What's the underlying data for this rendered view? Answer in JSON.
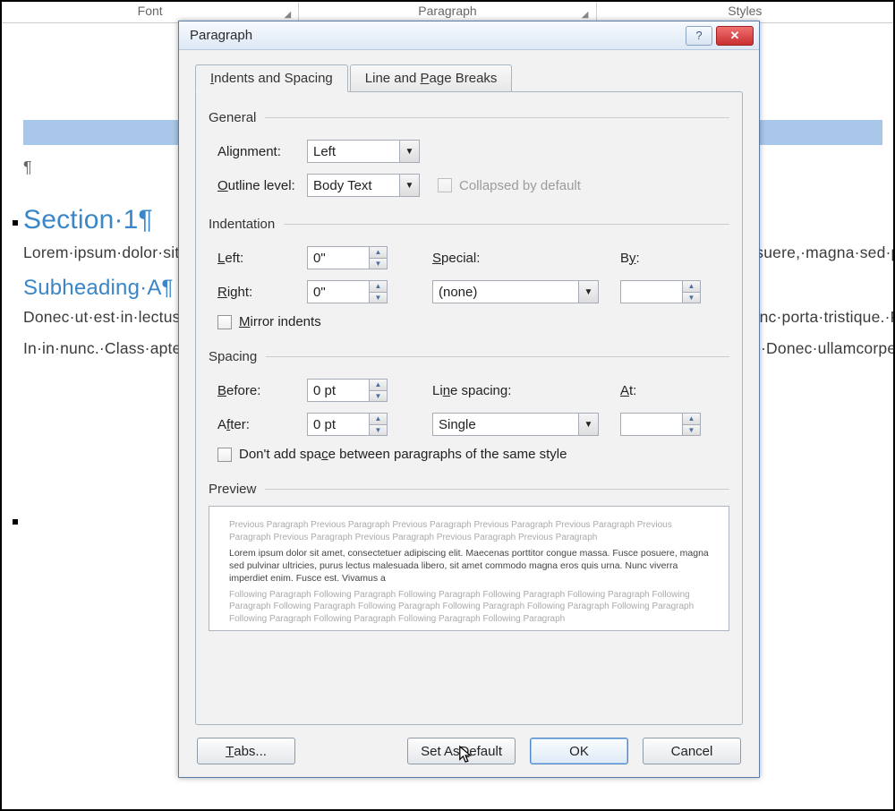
{
  "ribbon": {
    "font": "Font",
    "paragraph": "Paragraph",
    "styles": "Styles"
  },
  "doc": {
    "pilcrow": "¶",
    "h1": "Section·1¶",
    "p1": "Lorem·ipsum·dolor·sit·amet,·consectetuer·adipiscing·elit.·Maecenas·porttitor·congue·massa.·Fusce·posuere,·magna·sed·pulvinar·ultricies,·purus·lectus·malesuada·libero,·sit·amet·commodo·magna·eros·quis·urna.·Nunc·viverra·imperdiet·enim.·Fusce·est.·Vivamus·a·tellus.·Pellentesque·habitant·morbi·tristique·senectus·et·netus·et·malesuada·fames·ac·turpis·egestas.·Proin·pharetra·nonummy·pede.·Mauris·et·orci.·Aenean·nec·lorem.·In·porttitor.·Donec·laoreet·nonummy·augue.·Suspendisse·dui·purus,·scelerisque·at,·vulputate·vitae,·pretium·mattis,·nunc.·Mauris·eget·neque·at·sem·venenatis·eleifend.·Ut·nonummy.·Fusce·aliquet·pede·non·pede.·Suspendisse·dapibus·lorem·pellentesque·magna.·Integer·nulla.·Donec·blandit·feugiat·ligula.·Donec·hendrerit,·felis·et·imperdiet·euismod,·purus·ipsum·pretium·metus,·in·lacinia·nulla·nisl·eget·sapien.¶",
    "h2": "Subheading·A¶",
    "p2": "Donec·ut·est·in·lectus·consequat·consequat.·Etiam·eget·dui.·Aliquam·erat·volutpat.·Sed·at·lorem·in·nunc·porta·tristique.·Proin·nec·augue.·Quisque·aliquam·tempor·magna.·Pellentesque·habitant·morbi·tristique·senectus·et·netus·et·malesuada·fames·ac·turpis·egestas.·Nunc·ac·magna.·Maecenas·odio·dolor,·vulputate·vel,·auctor·ac,·accumsan·id,·felis.·Pellentesque·cursus·sagittis·felis.·Pellentesque·porttitor,·velit·lacinia·egestas·auctor,·diam·eros·tempus·arcu,·nec·vulputate·augue·magna·vel·risus.·Cras·non·magna·vel·ante·adipiscing·rhoncus.·Vivamus·a·mi.·Morbi·neque.·Aliquam·erat·volutpat.·Integer·ultrices·lobortis·eros.·Pellentesque·habitant·morbi·tristique·senectus·et·netus·et·malesuada·fames·ac·turpis·egestas.·Proin·semper,·ante·vitae·sollicitudin·posuere,·metus·quam·iaculis·nibh,·vitae·scelerisque·nunc·massa·eget·pede.·Sed·velit·urna,·interdum·vel,·ultricies·vel,·faucibus·at,·quam.·Donec·elit·est,·consectetuer·eget,·consequat·quis,·tempus·quis,·wisi.¶",
    "p3": "In·in·nunc.·Class·aptent·taciti·sociosqu·ad·litora·torquent·per·conubia·nostra,·per·inceptos·hymenaeos.·Donec·ullamcorper·fringilla·eros.·Fusce·in·sapien·eu·purus·dapibus·commodo.·Cum·sociis·natoque·"
  },
  "dialog": {
    "title": "Paragraph",
    "tabs": {
      "indents": "Indents and Spacing",
      "breaks": "Line and Page Breaks"
    },
    "general": {
      "label": "General",
      "alignment_lbl": "Alignment:",
      "alignment_val": "Left",
      "outline_lbl": "Outline level:",
      "outline_val": "Body Text",
      "collapsed": "Collapsed by default"
    },
    "indent": {
      "label": "Indentation",
      "left_lbl": "Left:",
      "left_val": "0\"",
      "right_lbl": "Right:",
      "right_val": "0\"",
      "special_lbl": "Special:",
      "special_val": "(none)",
      "by_lbl": "By:",
      "by_val": "",
      "mirror": "Mirror indents"
    },
    "spacing": {
      "label": "Spacing",
      "before_lbl": "Before:",
      "before_val": "0 pt",
      "after_lbl": "After:",
      "after_val": "0 pt",
      "line_lbl": "Line spacing:",
      "line_val": "Single",
      "at_lbl": "At:",
      "at_val": "",
      "same": "Don't add space between paragraphs of the same style"
    },
    "preview": {
      "label": "Preview",
      "prev": "Previous Paragraph Previous Paragraph Previous Paragraph Previous Paragraph Previous Paragraph Previous Paragraph Previous Paragraph Previous Paragraph Previous Paragraph Previous Paragraph",
      "sample": "Lorem ipsum dolor sit amet, consectetuer adipiscing elit. Maecenas porttitor congue massa. Fusce posuere, magna sed pulvinar ultricies, purus lectus malesuada libero, sit amet commodo magna eros quis urna. Nunc viverra imperdiet enim. Fusce est. Vivamus a",
      "foll": "Following Paragraph Following Paragraph Following Paragraph Following Paragraph Following Paragraph Following Paragraph Following Paragraph Following Paragraph Following Paragraph Following Paragraph Following Paragraph Following Paragraph Following Paragraph Following Paragraph Following Paragraph"
    },
    "buttons": {
      "tabs": "Tabs...",
      "default": "Set As Default",
      "ok": "OK",
      "cancel": "Cancel"
    }
  }
}
